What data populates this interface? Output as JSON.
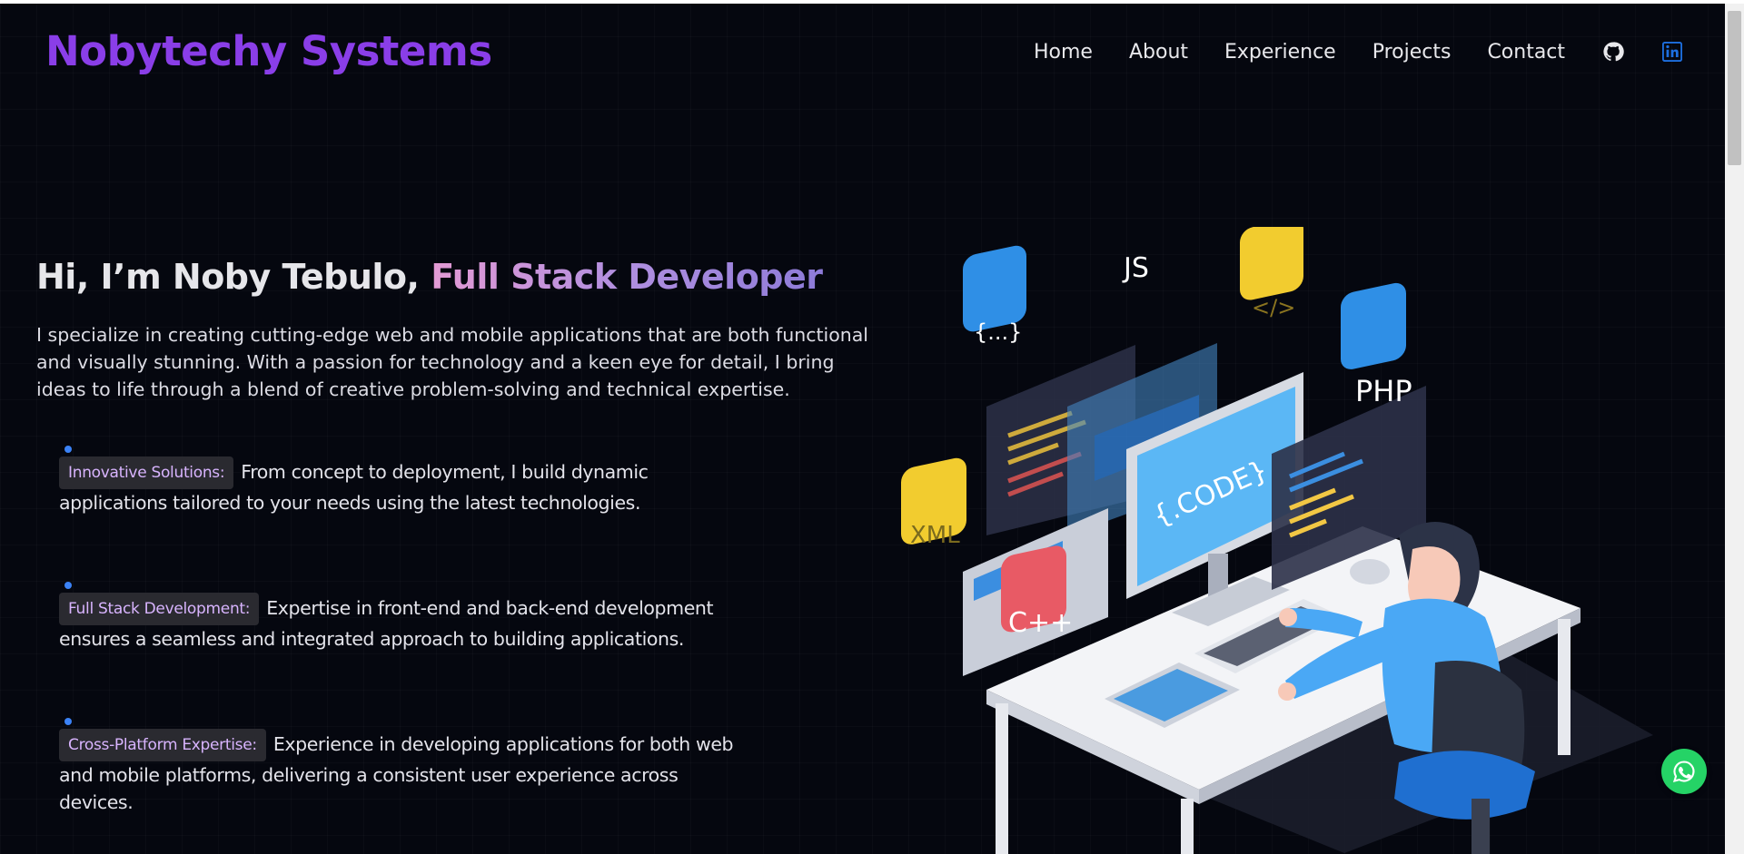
{
  "header": {
    "brand": "Nobytechy Systems",
    "nav": [
      "Home",
      "About",
      "Experience",
      "Projects",
      "Contact"
    ],
    "icons": [
      "github-icon",
      "linkedin-icon"
    ]
  },
  "hero": {
    "greeting": "Hi, I’m Noby Tebulo,",
    "role": "Full Stack Developer",
    "description": "I specialize in creating cutting-edge web and mobile applications that are both functional and visually stunning. With a passion for technology and a keen eye for detail, I bring ideas to life through a blend of creative problem-solving and technical expertise."
  },
  "features": [
    {
      "tag": "Innovative Solutions:",
      "text": "From concept to deployment, I build dynamic applications tailored to your needs using the latest technologies."
    },
    {
      "tag": "Full Stack Development:",
      "text": "Expertise in front-end and back-end development ensures a seamless and integrated approach to building applications."
    },
    {
      "tag": "Cross-Platform Expertise:",
      "text": "Experience in developing applications for both web and mobile platforms, delivering a consistent user experience across devices."
    }
  ],
  "illustration": {
    "badges": [
      "JS",
      "{...}",
      "</>",
      "PHP",
      "XML",
      "C++"
    ],
    "monitor_text": "{.CODE}"
  },
  "colors": {
    "brand": "#8a3ee8",
    "accent_dot": "#3b82f6",
    "tag_text": "#d8b4fe",
    "whatsapp": "#25d366",
    "linkedin": "#1d6fe0"
  }
}
